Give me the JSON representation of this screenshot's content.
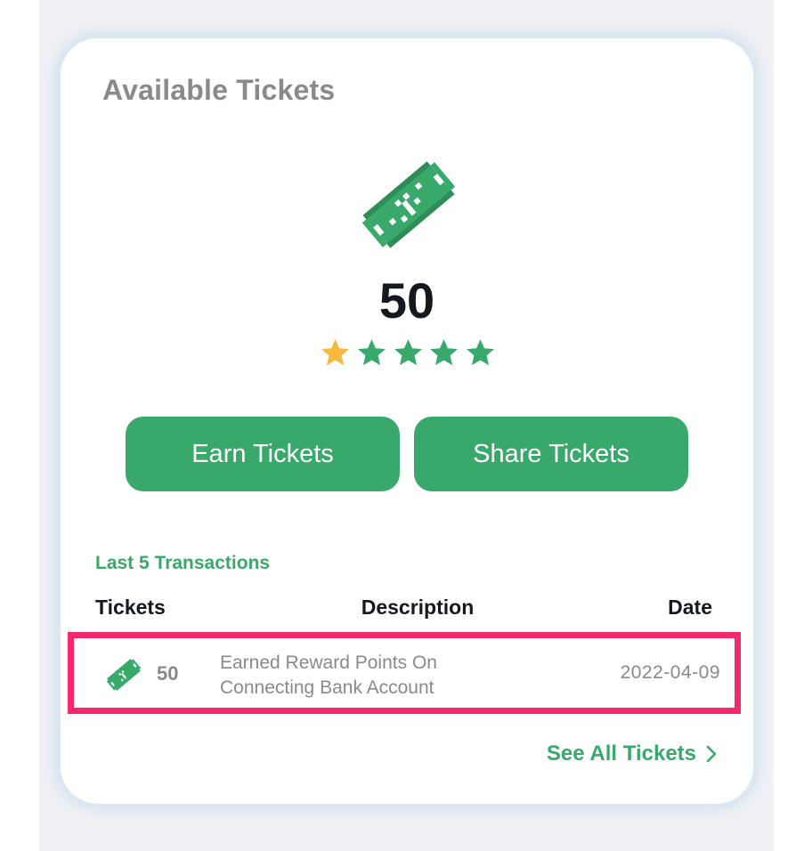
{
  "card": {
    "title": "Available Tickets",
    "ticket_count": "50",
    "rating": {
      "value": 1,
      "max": 5
    }
  },
  "buttons": {
    "earn_label": "Earn Tickets",
    "share_label": "Share Tickets"
  },
  "transactions": {
    "section_label": "Last 5 Transactions",
    "columns": [
      "Tickets",
      "Description",
      "Date"
    ],
    "rows": [
      {
        "tickets": "50",
        "description_line1": "Earned Reward Points On",
        "description_line2": "Connecting Bank Account",
        "date": "2022-04-09"
      }
    ],
    "see_all_label": "See All Tickets"
  },
  "icons": {
    "ticket": "ticket-icon",
    "star": "star-icon",
    "chevron": "chevron-right-icon"
  },
  "colors": {
    "accent_green": "#38a96b",
    "star_gold": "#f6b93b",
    "highlight": "#f4286a",
    "muted_text": "#8a8a8e",
    "dark_text": "#14181f"
  }
}
